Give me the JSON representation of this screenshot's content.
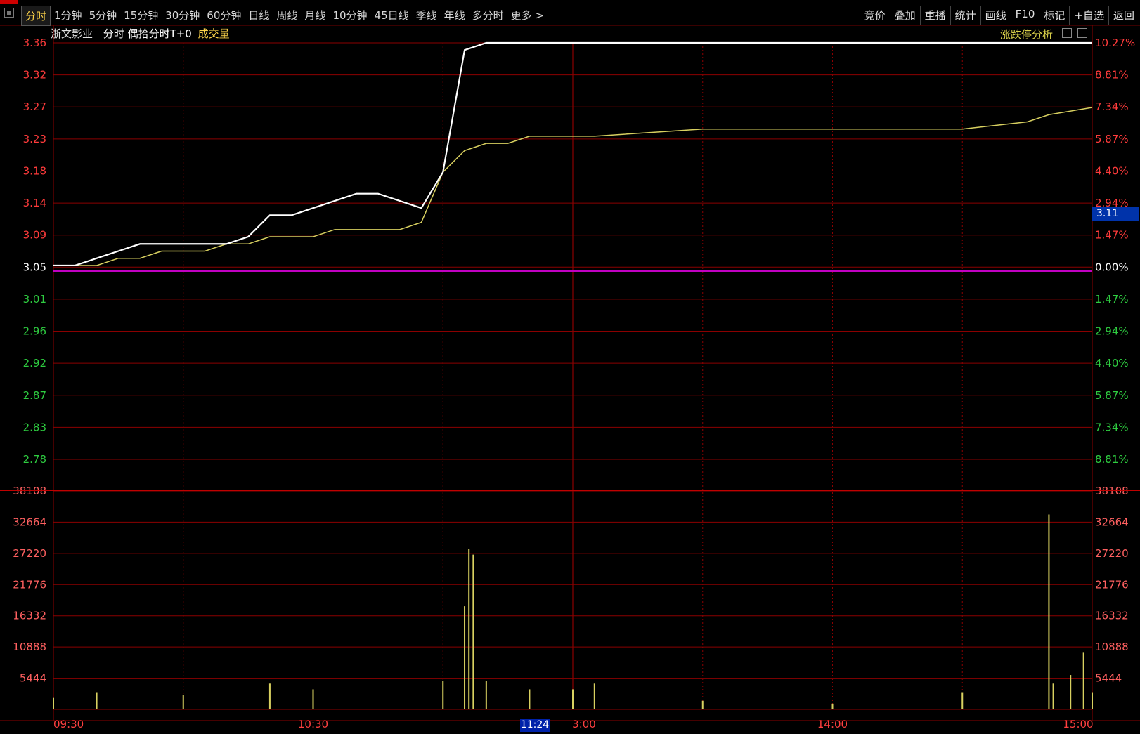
{
  "toolbar": {
    "tabs": [
      "分时",
      "1分钟",
      "5分钟",
      "15分钟",
      "30分钟",
      "60分钟",
      "日线",
      "周线",
      "月线",
      "10分钟",
      "45日线",
      "季线",
      "年线",
      "多分时",
      "更多 >"
    ],
    "active_tab": "分时",
    "right_buttons": [
      "竞价",
      "叠加",
      "重播",
      "统计",
      "画线",
      "F10",
      "标记",
      "+自选",
      "返回"
    ]
  },
  "info": {
    "stock_name": "浙文影业",
    "mode": "分时 偶拾分时T+0",
    "volume_label": "成交量",
    "limit_analysis": "涨跌停分析"
  },
  "cursor": {
    "price_tag": "3.11",
    "time_tag": "11:24"
  },
  "colors": {
    "background": "#000000",
    "grid": "#8b0000",
    "price_line": "#ffffff",
    "avg_line": "#d8d060",
    "volume_bar": "#d8d060",
    "prev_close_line": "#c000c0",
    "up_text": "#ff3b3b",
    "down_text": "#2ecc40"
  },
  "chart_data": [
    {
      "type": "line",
      "title": "",
      "x": [
        "09:30",
        "09:35",
        "09:40",
        "09:45",
        "09:50",
        "09:55",
        "10:00",
        "10:05",
        "10:10",
        "10:15",
        "10:20",
        "10:25",
        "10:30",
        "10:35",
        "10:40",
        "10:45",
        "10:50",
        "10:55",
        "11:00",
        "11:05",
        "11:10",
        "11:15",
        "11:20",
        "11:25",
        "11:30",
        "13:05",
        "13:30",
        "14:00",
        "14:30",
        "14:45",
        "14:50",
        "15:00"
      ],
      "series": [
        {
          "values": [
            3.05,
            3.05,
            3.06,
            3.07,
            3.08,
            3.08,
            3.08,
            3.08,
            3.08,
            3.09,
            3.12,
            3.12,
            3.13,
            3.14,
            3.15,
            3.15,
            3.14,
            3.13,
            3.18,
            3.35,
            3.36,
            3.36,
            3.36,
            3.36,
            3.36,
            3.36,
            3.36,
            3.36,
            3.36,
            3.36,
            3.36,
            3.36
          ]
        },
        {
          "values": [
            3.05,
            3.05,
            3.05,
            3.06,
            3.06,
            3.07,
            3.07,
            3.07,
            3.08,
            3.08,
            3.09,
            3.09,
            3.09,
            3.1,
            3.1,
            3.1,
            3.1,
            3.11,
            3.18,
            3.21,
            3.22,
            3.22,
            3.23,
            3.23,
            3.23,
            3.23,
            3.24,
            3.24,
            3.24,
            3.25,
            3.26,
            3.27
          ]
        }
      ],
      "y_ticks": [
        "3.36",
        "3.32",
        "3.27",
        "3.23",
        "3.18",
        "3.14",
        "3.09",
        "3.05",
        "3.01",
        "2.96",
        "2.92",
        "2.87",
        "2.83",
        "2.78"
      ],
      "pct_ticks": [
        "10.27%",
        "8.81%",
        "7.34%",
        "5.87%",
        "4.40%",
        "2.94%",
        "1.47%",
        "0.00%",
        "1.47%",
        "2.94%",
        "4.40%",
        "5.87%",
        "7.34%",
        "8.81%"
      ],
      "ylim": [
        2.78,
        3.36
      ],
      "prev_close": 3.05,
      "grid": true
    },
    {
      "type": "bar",
      "title": "",
      "ylabel": "",
      "categories": [
        "09:30",
        "09:40",
        "10:00",
        "10:20",
        "10:30",
        "11:00",
        "11:05",
        "11:06",
        "11:07",
        "11:10",
        "11:20",
        "11:30",
        "13:05",
        "13:30",
        "14:00",
        "14:30",
        "14:50",
        "14:51",
        "14:55",
        "14:58",
        "15:00"
      ],
      "values": [
        2000,
        3000,
        2500,
        4500,
        3500,
        5000,
        18000,
        28000,
        27000,
        5000,
        3500,
        3500,
        4500,
        1500,
        1000,
        3000,
        34000,
        4500,
        6000,
        10000,
        3000
      ],
      "y_ticks": [
        "38108",
        "32664",
        "27220",
        "21776",
        "16332",
        "10888",
        "5444"
      ],
      "ylim": [
        0,
        38108
      ],
      "grid": true
    }
  ],
  "x_tick_labels": [
    "09:30",
    "10:30",
    "11:24",
    "3:00",
    "14:00",
    "15:00"
  ]
}
